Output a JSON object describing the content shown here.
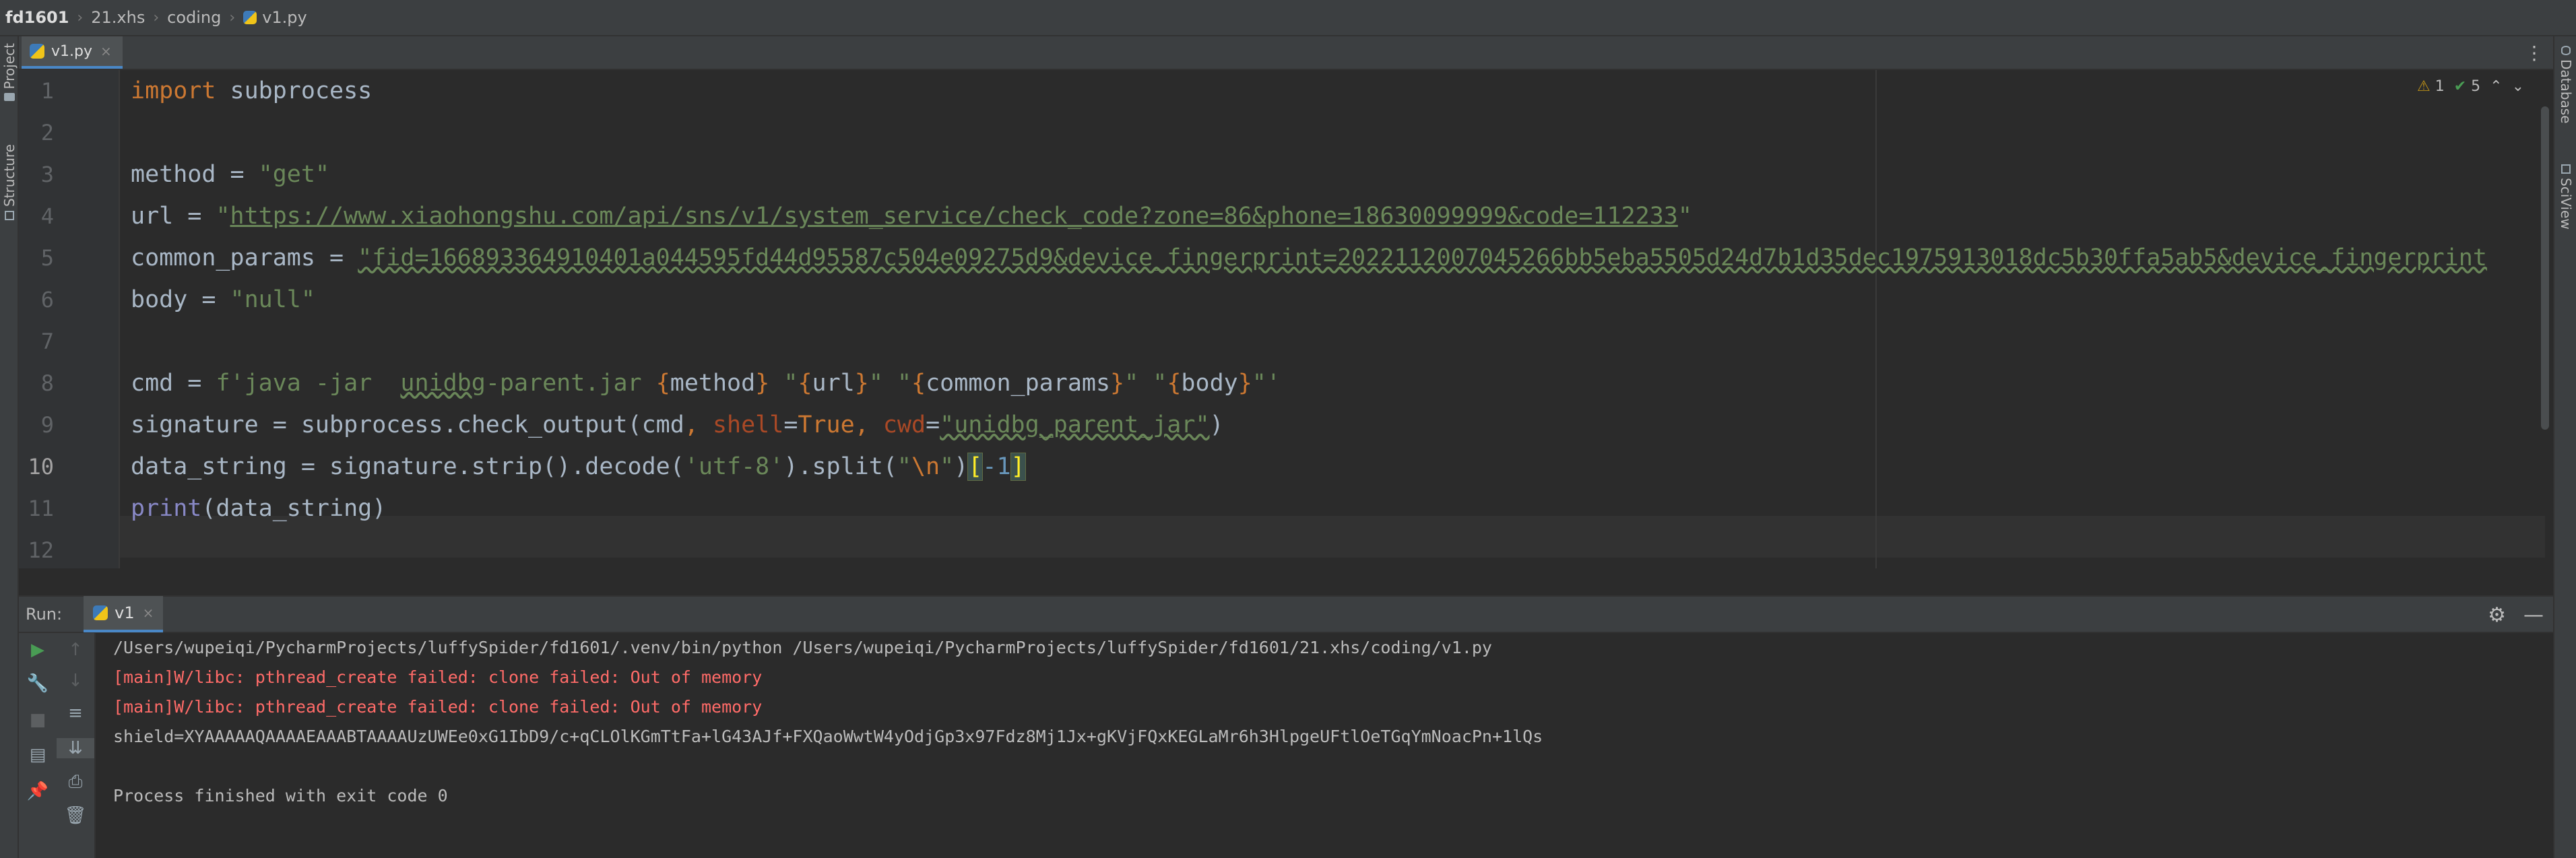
{
  "breadcrumb": [
    "fd1601",
    "21.xhs",
    "coding",
    "v1.py"
  ],
  "left_strip": {
    "project": "Project",
    "structure": "Structure"
  },
  "right_strip": {
    "database": "Database",
    "sciview": "SciView"
  },
  "editor_tabs": [
    {
      "label": "v1.py",
      "active": true
    }
  ],
  "inspection": {
    "warnings": "1",
    "weak_warnings": "5"
  },
  "code": {
    "current_line": 10,
    "line_numbers": [
      "1",
      "2",
      "3",
      "4",
      "5",
      "6",
      "7",
      "8",
      "9",
      "10",
      "11",
      "12"
    ],
    "l1": {
      "kw": "import",
      "rest": " subprocess"
    },
    "l3": {
      "a": "method = ",
      "s": "\"get\""
    },
    "l4": {
      "a": "url = ",
      "q1": "\"",
      "url": "https://www.xiaohongshu.com/api/sns/v1/system_service/check_code?zone=86&phone=18630099999&code=112233",
      "q2": "\""
    },
    "l5": {
      "a": "common_params = ",
      "s": "\"fid=166893364910401a044595fd44d95587c504e09275d9&device_fingerprint=2022112007045266bb5eba5505d24d7b1d35dec1975913018dc5b30ffa5ab5&device_fingerprint"
    },
    "l6": {
      "a": "body = ",
      "s": "\"null\""
    },
    "l8": {
      "a": "cmd = ",
      "f": "f'java -jar  ",
      "jar": "unidbg",
      "s2": "-parent.jar ",
      "b1": "{",
      "v1": "method",
      "b2": "}",
      "s3": " \"",
      "b3": "{",
      "v2": "url",
      "b4": "}",
      "s4": "\" \"",
      "b5": "{",
      "v3": "common_params",
      "b6": "}",
      "s5": "\" \"",
      "b7": "{",
      "v4": "body",
      "b8": "}",
      "s6": "\"'"
    },
    "l9": {
      "a": "signature = subprocess.check_output(cmd",
      "c1": ", ",
      "k1": "shell",
      "eq1": "=",
      "t": "True",
      "c2": ", ",
      "k2": "cwd",
      "eq2": "=",
      "s": "\"unidbg_parent_jar\"",
      "e": ")"
    },
    "l10": {
      "a": "data_string = signature.strip().decode(",
      "s1": "'utf-8'",
      "b": ").split(",
      "q1": "\"",
      "esc": "\\n",
      "q2": "\"",
      "c": ")",
      "o": "[",
      "n": "-1",
      "cl": "]"
    },
    "l11": {
      "fn": "print",
      "rest": "(data_string)"
    }
  },
  "run": {
    "label": "Run:",
    "tab": "v1",
    "output": [
      {
        "text": "/Users/wupeiqi/PycharmProjects/luffySpider/fd1601/.venv/bin/python /Users/wupeiqi/PycharmProjects/luffySpider/fd1601/21.xhs/coding/v1.py",
        "type": "normal"
      },
      {
        "text": "[main]W/libc: pthread_create failed: clone failed: Out of memory",
        "type": "error"
      },
      {
        "text": "[main]W/libc: pthread_create failed: clone failed: Out of memory",
        "type": "error"
      },
      {
        "text": "shield=XYAAAAAQAAAAEAAABTAAAAUzUWEe0xG1IbD9/c+qCLOlKGmTtFa+lG43AJf+FXQaoWwtW4yOdjGp3x97Fdz8Mj1Jx+gKVjFQxKEGLaMr6h3HlpgeUFtlOeTGqYmNoacPn+1lQs",
        "type": "normal"
      },
      {
        "text": "",
        "type": "normal"
      },
      {
        "text": "Process finished with exit code 0",
        "type": "normal"
      }
    ]
  },
  "colors": {
    "keyword": "#cc7832",
    "string": "#6a8759",
    "number": "#6897bb",
    "error": "#ff6b68",
    "accent": "#4a88c7"
  }
}
